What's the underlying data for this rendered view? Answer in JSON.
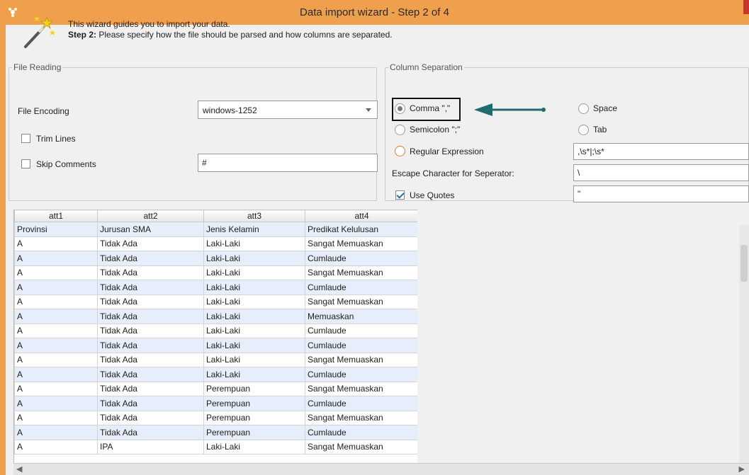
{
  "window": {
    "title": "Data import wizard - Step 2 of 4"
  },
  "intro": {
    "line1": "This wizard guides you to import your data.",
    "step_label": "Step 2:",
    "line2": "Please specify how the file should be parsed and how columns are separated."
  },
  "file_reading": {
    "legend": "File Reading",
    "encoding_label": "File Encoding",
    "encoding_value": "windows-1252",
    "trim_lines_label": "Trim Lines",
    "trim_lines_checked": false,
    "skip_comments_label": "Skip Comments",
    "skip_comments_checked": false,
    "comment_char": "#"
  },
  "column_separation": {
    "legend": "Column Separation",
    "comma_label": "Comma \",\"",
    "semicolon_label": "Semicolon \";\"",
    "regex_label": "Regular Expression",
    "regex_value": ",\\s*|;\\s*",
    "space_label": "Space",
    "tab_label": "Tab",
    "selected": "comma",
    "escape_label": "Escape Character for Seperator:",
    "escape_value": "\\",
    "use_quotes_label": "Use Quotes",
    "use_quotes_checked": true,
    "quote_value": "\""
  },
  "annotation": {
    "arrow_color": "#1f6b70"
  },
  "table": {
    "headers": [
      "att1",
      "att2",
      "att3",
      "att4"
    ],
    "rows": [
      [
        "Provinsi",
        "Jurusan SMA",
        "Jenis Kelamin",
        "Predikat Kelulusan"
      ],
      [
        "A",
        "Tidak Ada",
        "Laki-Laki",
        "Sangat Memuaskan"
      ],
      [
        "A",
        "Tidak Ada",
        "Laki-Laki",
        "Cumlaude"
      ],
      [
        "A",
        "Tidak Ada",
        "Laki-Laki",
        "Sangat Memuaskan"
      ],
      [
        "A",
        "Tidak Ada",
        "Laki-Laki",
        "Cumlaude"
      ],
      [
        "A",
        "Tidak Ada",
        "Laki-Laki",
        "Sangat Memuaskan"
      ],
      [
        "A",
        "Tidak Ada",
        "Laki-Laki",
        "Memuaskan"
      ],
      [
        "A",
        "Tidak Ada",
        "Laki-Laki",
        "Cumlaude"
      ],
      [
        "A",
        "Tidak Ada",
        "Laki-Laki",
        "Cumlaude"
      ],
      [
        "A",
        "Tidak Ada",
        "Laki-Laki",
        "Sangat Memuaskan"
      ],
      [
        "A",
        "Tidak Ada",
        "Laki-Laki",
        "Cumlaude"
      ],
      [
        "A",
        "Tidak Ada",
        "Perempuan",
        "Sangat Memuaskan"
      ],
      [
        "A",
        "Tidak Ada",
        "Perempuan",
        "Cumlaude"
      ],
      [
        "A",
        "Tidak Ada",
        "Perempuan",
        "Sangat Memuaskan"
      ],
      [
        "A",
        "Tidak Ada",
        "Perempuan",
        "Cumlaude"
      ],
      [
        "A",
        "IPA",
        "Laki-Laki",
        "Sangat Memuaskan"
      ]
    ]
  }
}
